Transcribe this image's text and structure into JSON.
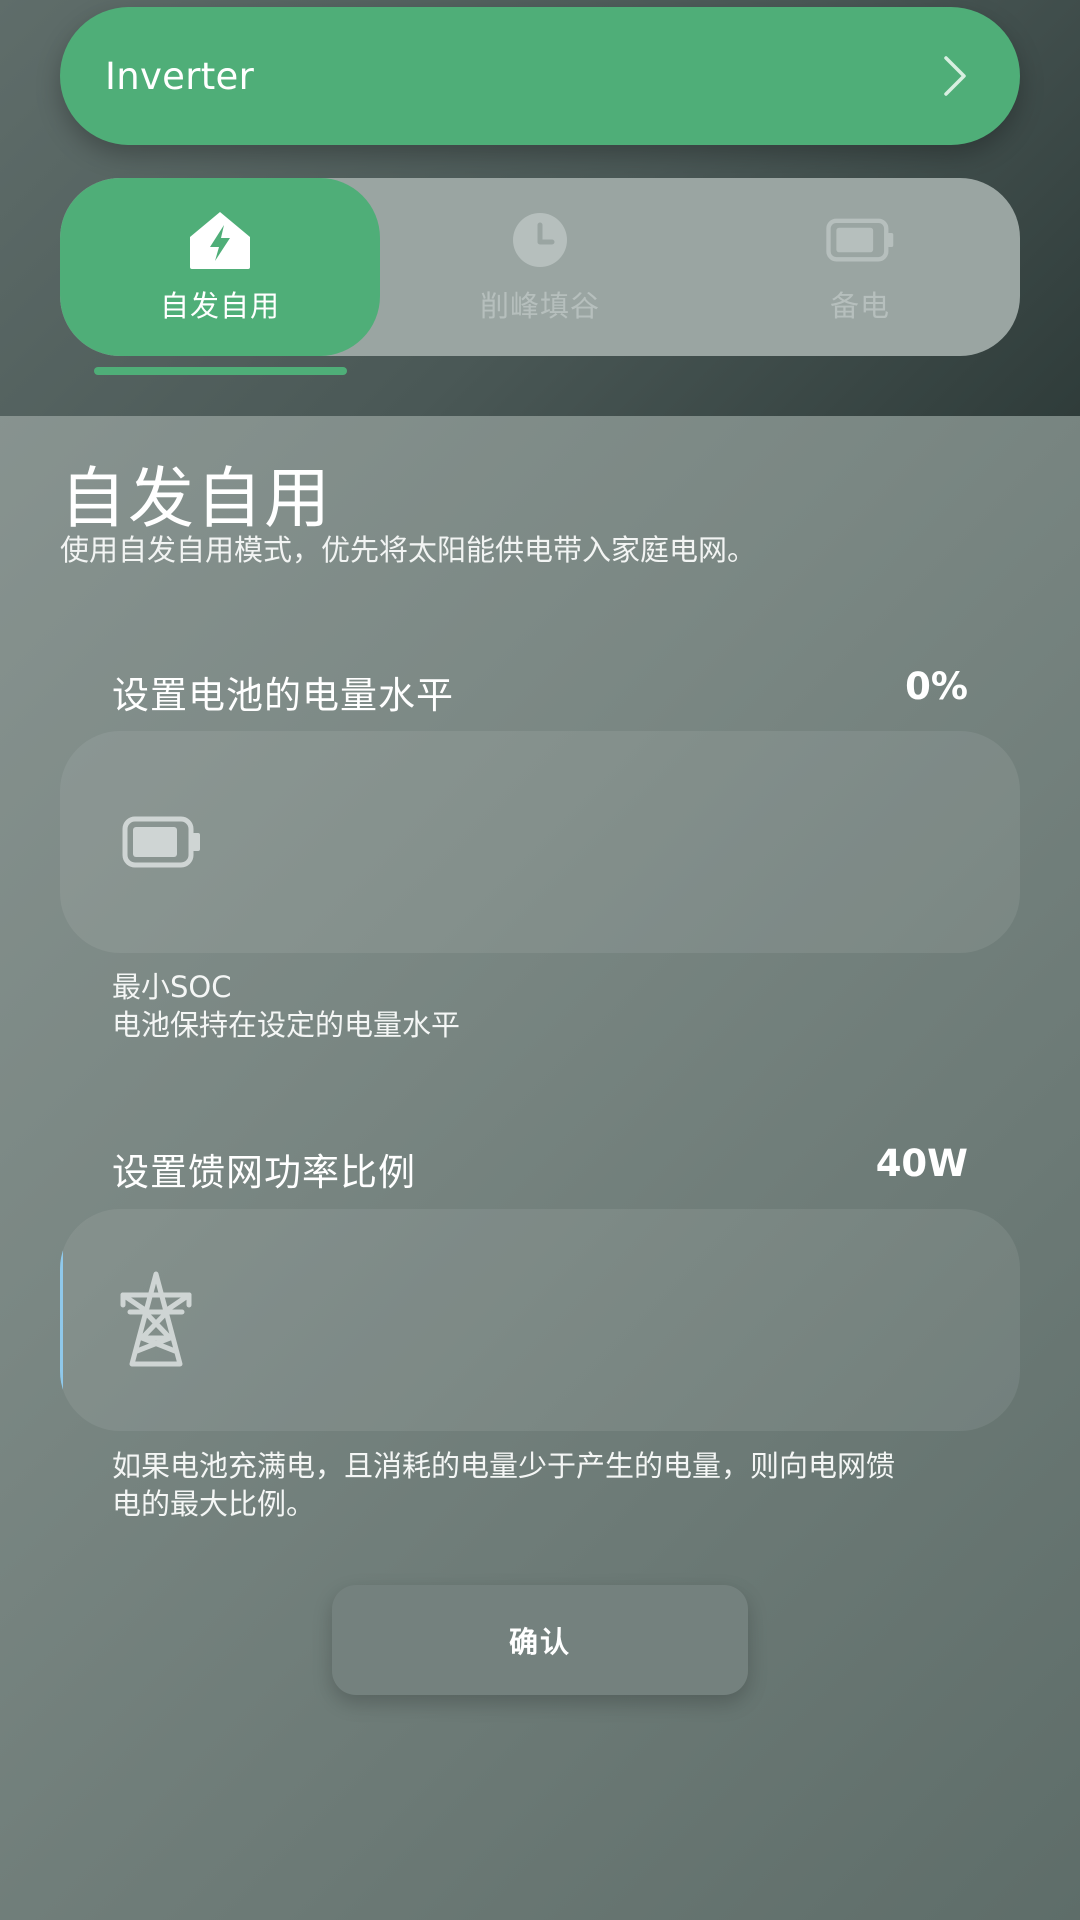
{
  "device": {
    "name": "Inverter"
  },
  "mode_tabs": [
    {
      "label": "自发自用",
      "icon": "home-bolt-icon",
      "active": true
    },
    {
      "label": "削峰填谷",
      "icon": "clock-icon",
      "active": false
    },
    {
      "label": "备电",
      "icon": "battery-icon",
      "active": false
    }
  ],
  "mode": {
    "title": "自发自用",
    "description": "使用自发自用模式，优先将太阳能供电带入家庭电网。"
  },
  "battery_level": {
    "label": "设置电池的电量水平",
    "value": "0%",
    "fraction": 0.0,
    "icon": "battery-icon",
    "hint_line1": "最小SOC",
    "hint_line2": "电池保持在设定的电量水平"
  },
  "grid_feed": {
    "label": "设置馈网功率比例",
    "value": "40W",
    "fraction": 0.003,
    "icon": "power-tower-icon",
    "hint_line1": "如果电池充满电，且消耗的电量少于产生的电量，则向电网馈",
    "hint_line2": "电的最大比例。"
  },
  "confirm": {
    "label": "确认"
  },
  "colors": {
    "accent": "#4fae78",
    "slider_fill": "#8fc8ea"
  }
}
